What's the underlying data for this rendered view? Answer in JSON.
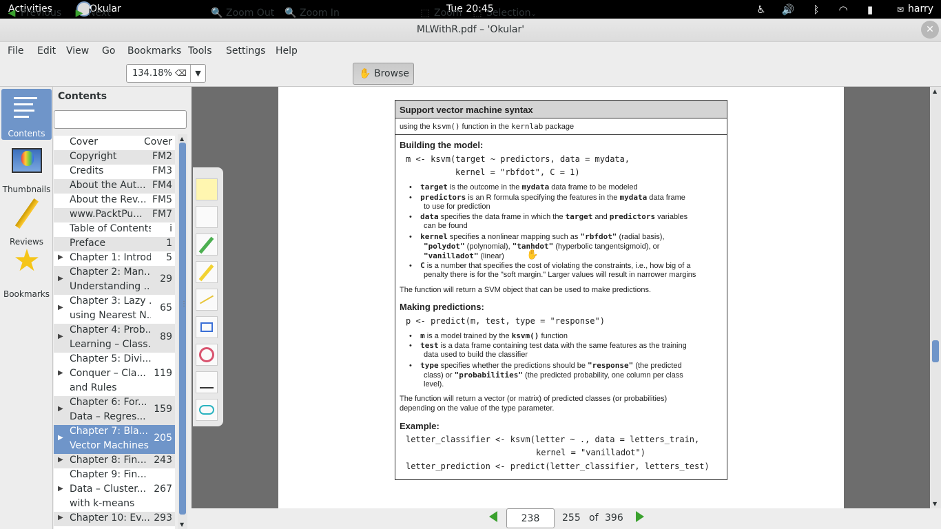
{
  "topbar": {
    "activities": "Activities",
    "app_name": "Okular",
    "clock": "Tue 20:45",
    "user": "harry"
  },
  "window": {
    "title": "MLWithR.pdf – 'Okular'",
    "close_glyph": "✕"
  },
  "menu": [
    "File",
    "Edit",
    "View",
    "Go",
    "Bookmarks",
    "Tools",
    "Settings",
    "Help"
  ],
  "toolbar": {
    "previous": "Previous",
    "next": "Next",
    "zoom_value": "134.18%",
    "zoom_out": "Zoom Out",
    "zoom_in": "Zoom In",
    "browse": "Browse",
    "zoom": "Zoom",
    "selection": "Selection"
  },
  "sidebar": {
    "buttons": [
      "Contents",
      "Thumbnails",
      "Reviews",
      "Bookmarks"
    ]
  },
  "contents": {
    "title": "Contents",
    "search_value": "",
    "items": [
      {
        "label": "Cover",
        "page": "Cover",
        "arrow": false,
        "shaded": false
      },
      {
        "label": "Copyright",
        "page": "FM2",
        "arrow": false,
        "shaded": true
      },
      {
        "label": "Credits",
        "page": "FM3",
        "arrow": false,
        "shaded": false
      },
      {
        "label": "About the Aut...",
        "page": "FM4",
        "arrow": false,
        "shaded": true
      },
      {
        "label": "About the Rev...",
        "page": "FM5",
        "arrow": false,
        "shaded": false
      },
      {
        "label": "www.PacktPu...",
        "page": "FM7",
        "arrow": false,
        "shaded": true
      },
      {
        "label": "Table of Contents",
        "page": "i",
        "arrow": false,
        "shaded": false
      },
      {
        "label": "Preface",
        "page": "1",
        "arrow": false,
        "shaded": true
      },
      {
        "label": "Chapter 1: Introd...",
        "page": "5",
        "arrow": true,
        "shaded": false
      },
      {
        "label": "Chapter 2: Man...",
        "label2": "Understanding ...",
        "page": "29",
        "arrow": true,
        "shaded": true
      },
      {
        "label": "Chapter 3: Lazy ...",
        "label2": "using Nearest N...",
        "page": "65",
        "arrow": true,
        "shaded": false
      },
      {
        "label": "Chapter 4: Prob...",
        "label2": "Learning – Class...",
        "page": "89",
        "arrow": true,
        "shaded": true
      },
      {
        "label": "Chapter 5: Divi...",
        "label2": "Conquer – Cla...",
        "label3": "and Rules",
        "page": "119",
        "arrow": true,
        "shaded": false
      },
      {
        "label": "Chapter 6: For...",
        "label2": "Data – Regres...",
        "page": "159",
        "arrow": true,
        "shaded": true
      },
      {
        "label": "Chapter 7: Bla...",
        "label2": "Vector Machines",
        "page": "205",
        "arrow": true,
        "selected": true
      },
      {
        "label": "Chapter 8: Fin...",
        "page": "243",
        "arrow": true,
        "shaded": true
      },
      {
        "label": "Chapter 9: Fin...",
        "label2": "Data – Cluster...",
        "label3": "with k-means",
        "page": "267",
        "arrow": true,
        "shaded": false
      },
      {
        "label": "Chapter 10: Ev...",
        "page": "293",
        "arrow": true,
        "shaded": true
      }
    ]
  },
  "document": {
    "box_title": "Support vector machine syntax",
    "box_subtitle_pre": "using the ",
    "box_subtitle_fn": "ksvm()",
    "box_subtitle_mid": " function in the ",
    "box_subtitle_pkg": "kernlab",
    "box_subtitle_post": " package",
    "building_heading": "Building the model:",
    "code_build_1": "m <- ksvm(target ~ predictors, data = mydata,",
    "code_build_2": "kernel = \"rbfdot\", C = 1)",
    "b1_term": "target",
    "b1_a": " is the outcome in the ",
    "b1_term2": "mydata",
    "b1_b": " data frame to be modeled",
    "b2_term": "predictors",
    "b2_a": " is an R formula specifying the features in the ",
    "b2_term2": "mydata",
    "b2_b": " data frame",
    "b2_c": "to use for prediction",
    "b3_term": "data",
    "b3_a": " specifies the data frame in which the ",
    "b3_term2": "target",
    "b3_b": " and ",
    "b3_term3": "predictors",
    "b3_c": " variables",
    "b3_d": "can be found",
    "b4_term": "kernel",
    "b4_a": " specifies a nonlinear mapping such as ",
    "b4_term2": "\"rbfdot\"",
    "b4_b": " (radial basis),",
    "b4_term3": "\"polydot\"",
    "b4_c": " (polynomial), ",
    "b4_term4": "\"tanhdot\"",
    "b4_d": " (hyperbolic tangentsigmoid), or",
    "b4_term5": "\"vanilladot\"",
    "b4_e": " (linear)",
    "b5_term": "C",
    "b5_a": " is a number that specifies the cost of violating the constraints, i.e., how big of a",
    "b5_b": "penalty there is for the \"soft margin.\" Larger values will result in narrower margins",
    "build_return": "The function will return a SVM object that can be used to make predictions.",
    "predict_heading": "Making predictions:",
    "code_pred": "p <- predict(m, test, type = \"response\")",
    "p1_term": "m",
    "p1_a": " is a model trained by the ",
    "p1_term2": "ksvm()",
    "p1_b": "  function",
    "p2_term": "test",
    "p2_a": " is a data frame containing test data with the same features as the training",
    "p2_b": "data used to build the classifier",
    "p3_term": "type",
    "p3_a": " specifies whether the predictions should be ",
    "p3_term2": "\"response\"",
    "p3_b": " (the predicted",
    "p3_c": "class) or ",
    "p3_term3": "\"probabilities\"",
    "p3_d": " (the predicted probability, one column per class",
    "p3_e": "level).",
    "pred_return_1": "The function will return a vector (or matrix) of predicted classes (or probabilities)",
    "pred_return_2": "depending on the value of the type parameter.",
    "example_heading": "Example:",
    "ex_1": "letter_classifier <- ksvm(letter ~ ., data = letters_train,",
    "ex_2": "kernel = \"vanilladot\")",
    "ex_3": "letter_prediction <- predict(letter_classifier, letters_test)"
  },
  "pager": {
    "current_page": "238",
    "page_label": "255",
    "of": "of",
    "total": "396"
  },
  "colors": {
    "selection": "#6f95c9",
    "nav_arrow": "#3aa12e"
  }
}
